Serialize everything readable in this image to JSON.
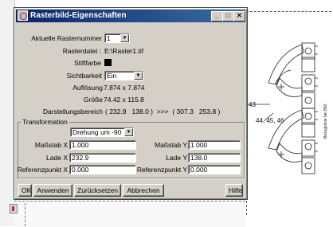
{
  "dialog": {
    "title": "Rasterbild-Eigenschaften",
    "minimize_glyph": "_",
    "maximize_glyph": "□",
    "close_glyph": "✕"
  },
  "properties": {
    "raster_number_label": "Aktuelle Rasternummer",
    "raster_number_value": "1",
    "raster_file_label": "Rasterdatei :",
    "raster_file_value": "E:\\Raster1.tif",
    "pen_color_label": "Stiftfarbe",
    "pen_color_value": "#000000",
    "visibility_label": "Sichtbarkeit",
    "visibility_value": "Ein",
    "resolution_label": "Auflösung",
    "resolution_value": "7.874 x 7.874",
    "size_label": "Größe",
    "size_value": "74.42 x 115.8",
    "display_area_label": "Darstellungsbereich",
    "display_area_value": "( 232.9   138.0 )  >>>  ( 307.3   253.8 )"
  },
  "transformation": {
    "group_label": "Transformation",
    "rotation_value": "Drehung um -90",
    "scale_x_label": "Maßstab X",
    "scale_x_value": "1.000",
    "scale_y_label": "Maßstab Y",
    "scale_y_value": "1.000",
    "pos_x_label": "Lade X",
    "pos_x_value": "232.9",
    "pos_y_label": "Lade Y",
    "pos_y_value": "138.0",
    "ref_x_label": "Referenzpunkt X",
    "ref_x_value": "0.000",
    "ref_y_label": "Referenzpunkt Y",
    "ref_y_value": "0.000"
  },
  "buttons": {
    "ok": "OK",
    "apply": "Anwenden",
    "reset": "Zurücksetzen",
    "cancel": "Abbrechen",
    "help": "Hilfe"
  },
  "drawing": {
    "label_43": "43",
    "label_44": "44, 45, 46",
    "label_vertical": "Bezugslinie bei 890"
  }
}
